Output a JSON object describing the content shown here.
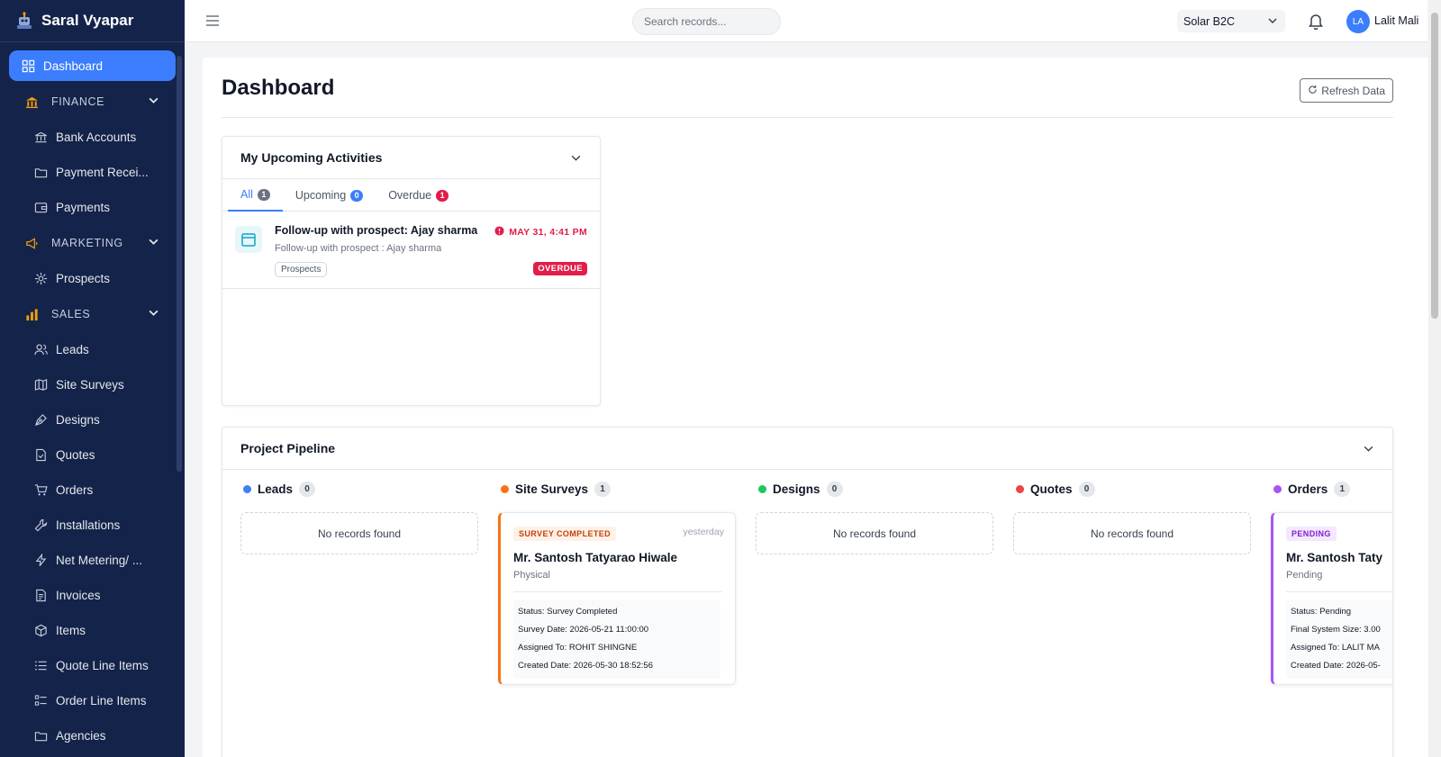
{
  "brand": {
    "name": "Saral Vyapar"
  },
  "sidebar": {
    "dashboard": "Dashboard",
    "finance": {
      "label": "FINANCE",
      "items": [
        "Bank Accounts",
        "Payment Recei...",
        "Payments"
      ]
    },
    "marketing": {
      "label": "MARKETING",
      "items": [
        "Prospects"
      ]
    },
    "sales": {
      "label": "SALES",
      "items": [
        "Leads",
        "Site Surveys",
        "Designs",
        "Quotes",
        "Orders",
        "Installations",
        "Net Metering/ ...",
        "Invoices",
        "Items",
        "Quote Line Items",
        "Order Line Items",
        "Agencies"
      ]
    }
  },
  "topbar": {
    "search_placeholder": "Search records...",
    "org": "Solar B2C",
    "user_initials": "LA",
    "user_name": "Lalit Mali"
  },
  "page": {
    "title": "Dashboard",
    "refresh_label": "Refresh Data"
  },
  "activities": {
    "title": "My Upcoming Activities",
    "tabs": [
      {
        "label": "All",
        "count": "1"
      },
      {
        "label": "Upcoming",
        "count": "0"
      },
      {
        "label": "Overdue",
        "count": "1"
      }
    ],
    "items": [
      {
        "title": "Follow-up with prospect: Ajay sharma",
        "subtitle": "Follow-up with prospect : Ajay sharma",
        "tag": "Prospects",
        "date": "MAY 31, 4:41 PM",
        "status": "OVERDUE"
      }
    ]
  },
  "pipeline": {
    "title": "Project Pipeline",
    "empty_text": "No records found",
    "columns": [
      {
        "name": "Leads",
        "count": "0",
        "color": "#3b82f6"
      },
      {
        "name": "Site Surveys",
        "count": "1",
        "color": "#f97316"
      },
      {
        "name": "Designs",
        "count": "0",
        "color": "#22c55e"
      },
      {
        "name": "Quotes",
        "count": "0",
        "color": "#ef4444"
      },
      {
        "name": "Orders",
        "count": "1",
        "color": "#a855f7"
      }
    ],
    "survey_record": {
      "badge": "SURVEY COMPLETED",
      "time": "yesterday",
      "name": "Mr. Santosh Tatyarao Hiwale",
      "type": "Physical",
      "lines": [
        "Status: Survey Completed",
        "Survey Date: 2026-05-21 11:00:00",
        "Assigned To: ROHIT SHINGNE",
        "Created Date: 2026-05-30 18:52:56"
      ]
    },
    "order_record": {
      "badge": "PENDING",
      "name": "Mr. Santosh Taty",
      "type": "Pending",
      "lines": [
        "Status: Pending",
        "Final System Size: 3.00",
        "Assigned To: LALIT MA",
        "Created Date: 2026-05-"
      ]
    }
  }
}
